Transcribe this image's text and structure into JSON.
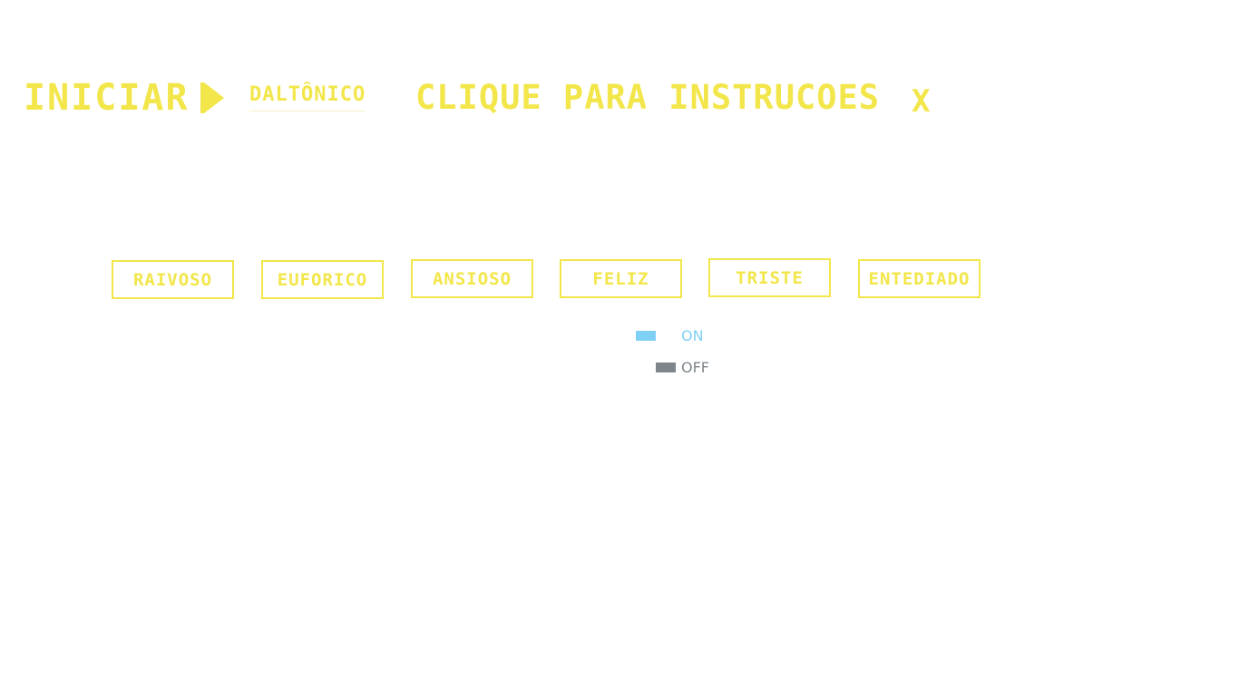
{
  "header": {
    "start_label": "INICIAR",
    "daltonic_label": "DALTÔNICO",
    "instructions_label": "CLIQUE PARA INSTRUCOES",
    "close_label": "X"
  },
  "moods": [
    {
      "label": "RAIVOSO"
    },
    {
      "label": "EUFORICO"
    },
    {
      "label": "ANSIOSO"
    },
    {
      "label": "FELIZ"
    },
    {
      "label": "TRISTE"
    },
    {
      "label": "ENTEDIADO"
    }
  ],
  "toggle": {
    "on_label": "ON",
    "off_label": "OFF"
  },
  "colors": {
    "accent": "#f2e64a",
    "on": "#7fd0f5",
    "off": "#7f868b"
  }
}
